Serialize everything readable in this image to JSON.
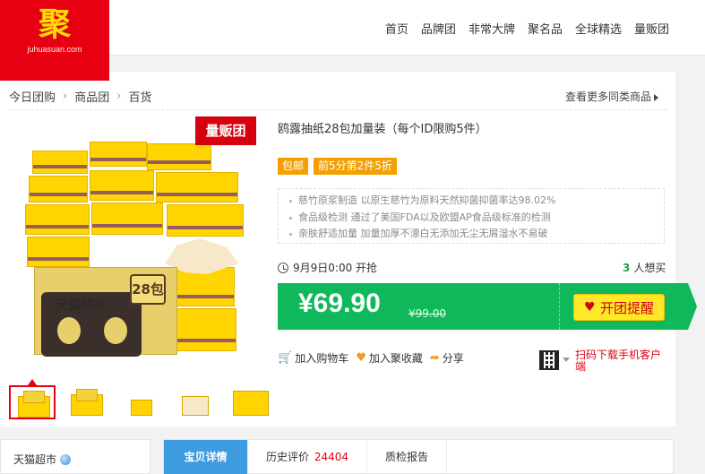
{
  "logo": {
    "char": "聚",
    "url": "juhuasuan.com"
  },
  "nav": [
    "首页",
    "品牌团",
    "非常大牌",
    "聚名品",
    "全球精选",
    "量贩团"
  ],
  "breadcrumb": [
    "今日团购",
    "商品团",
    "百货"
  ],
  "more_link": "查看更多同类商品",
  "image": {
    "tag": "量贩团",
    "pack_title": "天猫超市",
    "pack_count": "28包"
  },
  "product": {
    "title": "鸥露抽纸28包加量装（每个ID限购5件）",
    "badges": [
      "包邮",
      "前5分第2件5折"
    ],
    "features": [
      "慈竹原浆制造 以原生慈竹为原料天然抑菌抑菌率达98.02%",
      "食品级检测 通过了美国FDA以及欧盟AP食品级标准的检测",
      "亲肤舒适加量 加量加厚不漂白无添加无尘无屑湿水不易破"
    ],
    "start_time": "9月9日0:00 开抢",
    "buyers_count": "3",
    "buyers_label": "人想买",
    "price": "¥69.90",
    "old_price": "¥99.00",
    "remind_label": "开团提醒"
  },
  "actions": {
    "cart": "加入购物车",
    "fav": "加入聚收藏",
    "share": "分享"
  },
  "qr_text": "扫码下载手机客户端",
  "store_name": "天猫超市",
  "tabs": {
    "detail": "宝贝详情",
    "reviews": "历史评价",
    "reviews_count": "24404",
    "report": "质检报告"
  },
  "colors": {
    "brand_red": "#e60012",
    "price_green": "#0fb85a",
    "badge_orange": "#f5a000",
    "tab_blue": "#3d9be0"
  }
}
